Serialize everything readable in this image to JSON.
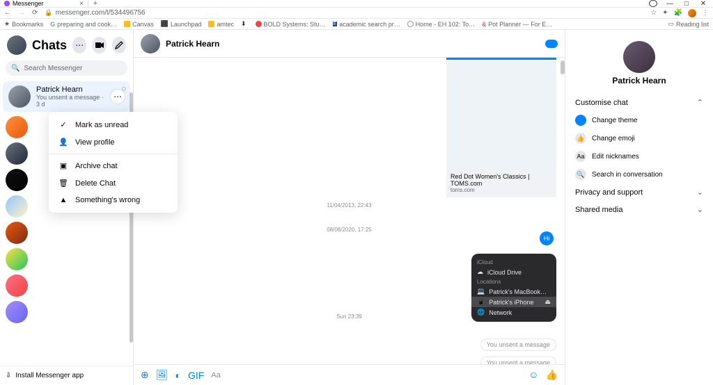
{
  "browser": {
    "tab_title": "Messenger",
    "url": "messenger.com/t/534496756",
    "bookmarks": [
      "Bookmarks",
      "preparing and cook…",
      "Canvas",
      "Launchpad",
      "amtec",
      "",
      "BOLD Systems: Stu…",
      "academic search pr…",
      "Home - EH 102: To…",
      "Pot Planner — For E…"
    ],
    "reading_list": "Reading list"
  },
  "sidebar": {
    "title": "Chats",
    "search_placeholder": "Search Messenger",
    "active": {
      "name": "Patrick Hearn",
      "sub": "You unsent a message · 3 d"
    },
    "install": "Install Messenger app"
  },
  "context_menu": {
    "items": [
      "Mark as unread",
      "View profile",
      "Archive chat",
      "Delete Chat",
      "Something's wrong"
    ]
  },
  "chat": {
    "header_name": "Patrick Hearn",
    "link_preview": {
      "title": "Red Dot Women's Classics | TOMS.com",
      "domain": "toms.com"
    },
    "ts1": "11/04/2013, 22:43",
    "ts2": "08/08/2020, 17:25",
    "ts3": "Sun 23:39",
    "hi": "Hi",
    "icloud": {
      "header": "iCloud",
      "drive": "iCloud Drive",
      "locations": "Locations",
      "mac": "Patrick's MacBook…",
      "iphone": "Patrick's iPhone",
      "network": "Network"
    },
    "unsent": "You unsent a message",
    "composer_placeholder": "Aa"
  },
  "rightpanel": {
    "name": "Patrick Hearn",
    "sections": {
      "customise": "Customise chat",
      "privacy": "Privacy and support",
      "media": "Shared media"
    },
    "opts": {
      "theme": "Change theme",
      "emoji": "Change emoji",
      "nick": "Edit nicknames",
      "search": "Search in conversation"
    }
  }
}
